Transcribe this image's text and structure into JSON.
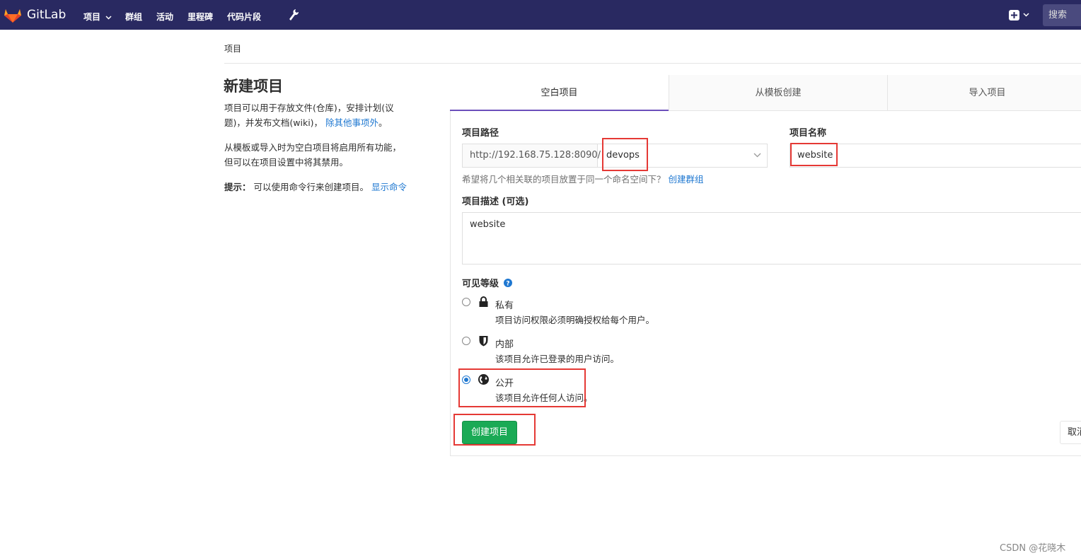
{
  "header": {
    "brand": "GitLab",
    "nav": [
      "项目",
      "群组",
      "活动",
      "里程碑",
      "代码片段"
    ],
    "search_placeholder": "搜索",
    "colors": {
      "background": "#292961",
      "logo": "#e24329"
    },
    "icons": [
      "gitlab-logo",
      "chevron-down-icon",
      "wrench-icon",
      "plus-square-icon"
    ]
  },
  "breadcrumb": "项目",
  "sidebar": {
    "title": "新建项目",
    "desc1_a": "项目可以用于存放文件(仓库)，安排计划(议",
    "desc1_b": "题)，并发布文档(wiki)，",
    "desc1_link": "除其他事项外",
    "desc1_end": "。",
    "desc2_a": "从模板或导入时为空白项目将启用所有功能，",
    "desc2_b": "但可以在项目设置中将其禁用。",
    "tip_label": "提示：",
    "tip_text": "可以使用命令行来创建项目。",
    "tip_link": "显示命令"
  },
  "tabs": [
    "空白项目",
    "从模板创建",
    "导入项目"
  ],
  "form": {
    "path_label": "项目路径",
    "path_prefix": "http://192.168.75.128:8090/",
    "namespace": "devops",
    "name_label": "项目名称",
    "name_value": "website",
    "help_text": "希望将几个相关联的项目放置于同一个命名空间下？",
    "help_link": "创建群组",
    "desc_label": "项目描述 (可选)",
    "desc_value": "website",
    "visibility_label": "可见等级",
    "visibility": [
      {
        "title": "私有",
        "desc": "项目访问权限必须明确授权给每个用户。",
        "checked": false,
        "icon": "lock-icon"
      },
      {
        "title": "内部",
        "desc": "该项目允许已登录的用户访问。",
        "checked": false,
        "icon": "shield-icon"
      },
      {
        "title": "公开",
        "desc": "该项目允许任何人访问。",
        "checked": true,
        "icon": "globe-icon"
      }
    ],
    "create_button": "创建项目",
    "cancel_button": "取消"
  },
  "watermark": "CSDN @花晓木"
}
